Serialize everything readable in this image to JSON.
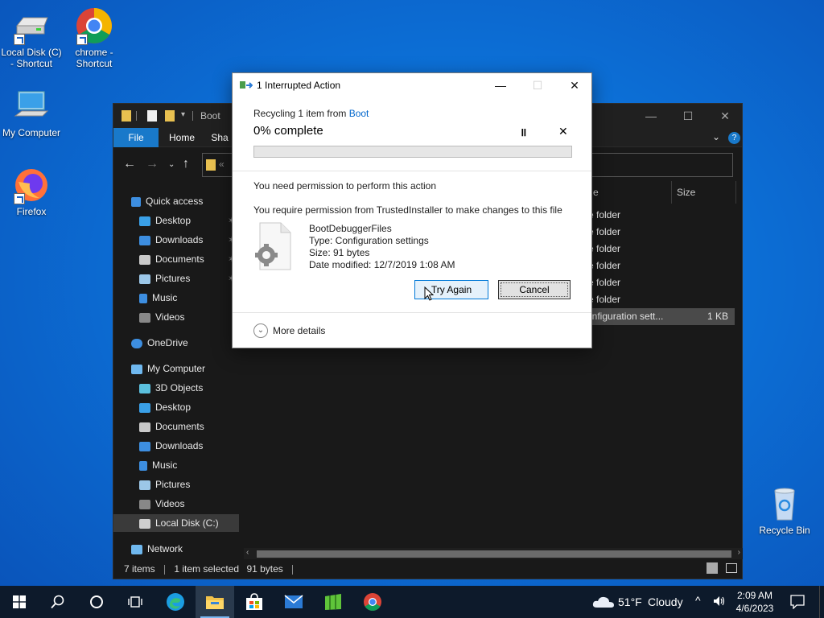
{
  "desktop": {
    "icons": [
      {
        "label": "Local Disk (C) - Shortcut"
      },
      {
        "label": "chrome - Shortcut"
      },
      {
        "label": "My Computer"
      },
      {
        "label": "Firefox"
      },
      {
        "label": "Recycle Bin"
      }
    ]
  },
  "explorer": {
    "title": "Boot",
    "ribbon_tabs": [
      "File",
      "Home",
      "Sha"
    ],
    "address_chevron": "«",
    "sidebar": [
      {
        "label": "Quick access"
      },
      {
        "label": "Desktop"
      },
      {
        "label": "Downloads"
      },
      {
        "label": "Documents"
      },
      {
        "label": "Pictures"
      },
      {
        "label": "Music"
      },
      {
        "label": "Videos"
      },
      {
        "label": "OneDrive"
      },
      {
        "label": "My Computer"
      },
      {
        "label": "3D Objects"
      },
      {
        "label": "Desktop"
      },
      {
        "label": "Documents"
      },
      {
        "label": "Downloads"
      },
      {
        "label": "Music"
      },
      {
        "label": "Pictures"
      },
      {
        "label": "Videos"
      },
      {
        "label": "Local Disk (C:)"
      },
      {
        "label": "Network"
      }
    ],
    "column_partial": "e",
    "column_size": "Size",
    "rows": [
      {
        "type": "e folder",
        "size": ""
      },
      {
        "type": "e folder",
        "size": ""
      },
      {
        "type": "e folder",
        "size": ""
      },
      {
        "type": "e folder",
        "size": ""
      },
      {
        "type": "e folder",
        "size": ""
      },
      {
        "type": "e folder",
        "size": ""
      },
      {
        "type": "onfiguration sett...",
        "size": "1 KB"
      }
    ],
    "status": {
      "items": "7 items",
      "selected": "1 item selected",
      "size": "91 bytes"
    }
  },
  "dialog": {
    "title": "1 Interrupted Action",
    "recycling_prefix": "Recycling 1 item from ",
    "recycling_link": "Boot",
    "progress_label": "0% complete",
    "progress_fraction": 0,
    "permission_heading": "You need permission to perform this action",
    "permission_detail": "You require permission from TrustedInstaller to make changes to this file",
    "file": {
      "name": "BootDebuggerFiles",
      "type": "Type: Configuration settings",
      "size": "Size: 91 bytes",
      "modified": "Date modified: 12/7/2019 1:08 AM"
    },
    "try_again_label": "Try Again",
    "cancel_label": "Cancel",
    "more_details_label": "More details"
  },
  "taskbar": {
    "weather_temp": "51°F",
    "weather_desc": "Cloudy",
    "time": "2:09 AM",
    "date": "4/6/2023"
  },
  "colors": {
    "accent": "#0078d7",
    "link": "#0066cc",
    "desktop_bg": "#0c6fd6",
    "explorer_bg": "#191919"
  }
}
